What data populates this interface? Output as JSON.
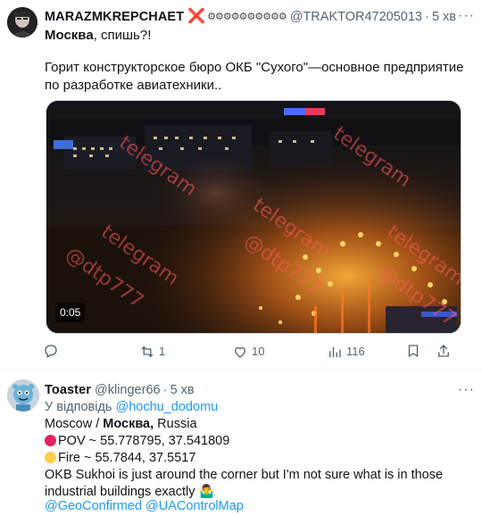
{
  "tweet1": {
    "author_name": "MARAZMKREPCHAET",
    "badge": "❌",
    "badge_chain": "⚙⚙⚙⚙⚙⚙⚙⚙⚙⚙",
    "handle": "@TRAKTOR47205013",
    "separator": "·",
    "time": "5 хв",
    "more": "···",
    "text_bold": "Москва",
    "text_rest": ", спишь?!",
    "text_body": "Горит конструкторское бюро ОКБ \"Сухого\"—основное предприятие по разработке авиатехники..",
    "media": {
      "duration": "0:05",
      "watermark": "telegram @dtp777"
    },
    "actions": {
      "reply_count": "",
      "retweet_count": "1",
      "like_count": "10",
      "views_count": "116"
    }
  },
  "tweet2": {
    "author_name": "Toaster",
    "handle": "@klinger66",
    "separator": "·",
    "time": "5 хв",
    "more": "···",
    "reply_prefix": "У відповідь",
    "reply_to": "@hochu_dodomu",
    "line1_a": "Moscow / ",
    "line1_bold": "Москва,",
    "line1_b": " Russia",
    "pov": "POV ~ 55.778795, 37.541809",
    "fire": "Fire ~  55.7844, 37.5517",
    "line4": "OKB Sukhoi is just around the corner but I'm not sure what is in those",
    "line5": "industrial buildings exactly 🤷‍♂️",
    "mention1": "@GeoConfirmed",
    "mention2": "@UAControlMap"
  }
}
